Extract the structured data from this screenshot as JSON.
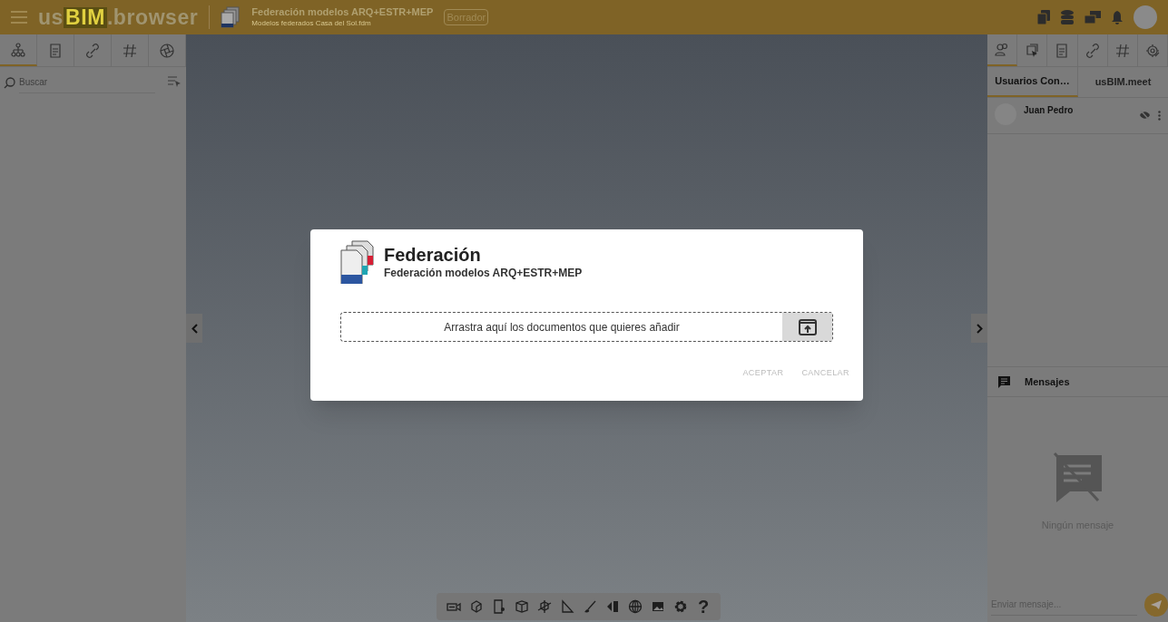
{
  "header": {
    "logo": [
      "us",
      "BIM",
      ".browser"
    ],
    "doc_title": "Federación modelos ARQ+ESTR+MEP",
    "doc_subtitle": "Modelos federados Casa del Sol.fdm",
    "status_badge": "Borrador"
  },
  "left_panel": {
    "tabs": [
      {
        "selected": true
      },
      {
        "selected": false
      },
      {
        "selected": false
      },
      {
        "selected": false
      },
      {
        "selected": false
      }
    ],
    "search": {
      "placeholder": "Buscar"
    }
  },
  "right_panel": {
    "tabs": [
      {
        "selected": true
      },
      {
        "selected": false
      },
      {
        "selected": false
      },
      {
        "selected": false
      },
      {
        "selected": false
      },
      {
        "selected": false
      }
    ],
    "subtabs": [
      {
        "label": "Usuarios Con…",
        "selected": true
      },
      {
        "label": "usBIM.meet",
        "selected": false
      }
    ],
    "users": [
      {
        "name": "Juan Pedro"
      }
    ],
    "messages": {
      "title": "Mensajes",
      "empty_text": "Ningún mensaje",
      "input": {
        "placeholder": "Enviar mensaje..."
      }
    }
  },
  "dialog": {
    "title": "Federación",
    "subtitle": "Federación modelos ARQ+ESTR+MEP",
    "dropzone_text": "Arrastra aquí los documentos que quieres añadir",
    "buttons": [
      {
        "label": "ACEPTAR",
        "disabled": true
      },
      {
        "label": "CANCELAR",
        "disabled": true
      }
    ]
  },
  "toolbar": {
    "help_label": "?"
  }
}
